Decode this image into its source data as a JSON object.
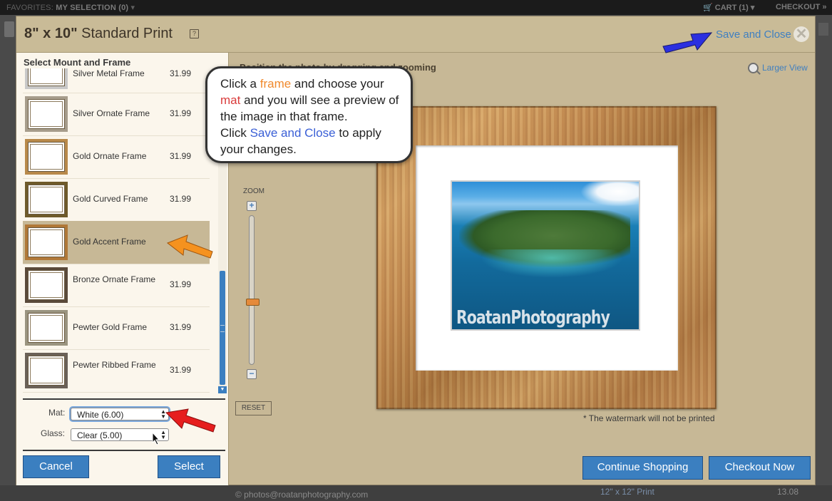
{
  "topbar": {
    "favorites_label": "FAVORITES:",
    "my_selection": "MY SELECTION (0)",
    "cart": "CART (1)",
    "checkout": "CHECKOUT »"
  },
  "modal": {
    "title_size": "8\" x 10\"",
    "title_type": "Standard Print",
    "help": "?",
    "save_close": "Save and Close",
    "close_glyph": "✕"
  },
  "left_panel": {
    "title": "Select Mount and Frame",
    "frames": [
      {
        "name": "Silver Metal Frame",
        "price": "31.99"
      },
      {
        "name": "Silver Ornate Frame",
        "price": "31.99"
      },
      {
        "name": "Gold Ornate Frame",
        "price": "31.99"
      },
      {
        "name": "Gold Curved Frame",
        "price": "31.99"
      },
      {
        "name": "Gold Accent Frame",
        "price": ""
      },
      {
        "name": "Bronze Ornate Frame",
        "price": "31.99"
      },
      {
        "name": "Pewter Gold Frame",
        "price": "31.99"
      },
      {
        "name": "Pewter Ribbed Frame",
        "price": "31.99"
      }
    ],
    "selected_frame": "Gold Accent Frame",
    "mat_label": "Mat:",
    "mat_value": "White (6.00)",
    "glass_label": "Glass:",
    "glass_value": "Clear (5.00)",
    "cancel": "Cancel",
    "select": "Select"
  },
  "preview": {
    "heading": "Position the photo by dragging and zooming",
    "larger_view": "Larger View",
    "zoom_label": "ZOOM",
    "zoom_plus": "+",
    "zoom_minus": "−",
    "zoom_level": 0.58,
    "reset": "RESET",
    "watermark_text": "RoatanPhotography",
    "watermark_note": "* The watermark will not be printed",
    "continue_shopping": "Continue Shopping",
    "checkout_now": "Checkout Now"
  },
  "callout": {
    "t1": "Click a ",
    "frame": "frame",
    "t2": " and choose your ",
    "mat": "mat",
    "t3": " and you will see a preview of the image in that frame.",
    "t4": "Click ",
    "save_close": "Save and Close",
    "t5": " to apply your changes."
  },
  "footer": {
    "email": "© photos@roatanphotography.com",
    "print_label": "12\" x 12\" Print",
    "price": "13.08"
  },
  "colors": {
    "accent_blue": "#3b7fc0",
    "selected_row": "#c7b896",
    "modal_bg": "#c7b896",
    "arrow_blue": "#2b2fe0",
    "arrow_orange": "#f5921f",
    "arrow_red": "#e61e1e"
  }
}
